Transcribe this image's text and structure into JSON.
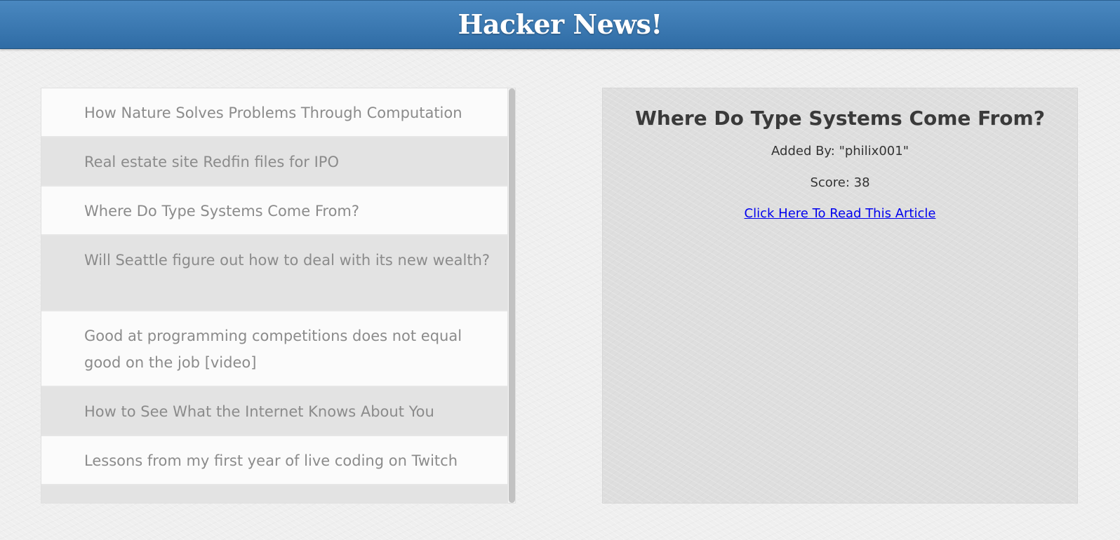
{
  "header": {
    "title": "Hacker News!",
    "background": "#3a78b2"
  },
  "stories": [
    {
      "title": "How Nature Solves Problems Through Computation"
    },
    {
      "title": "Real estate site Redfin files for IPO"
    },
    {
      "title": "Where Do Type Systems Come From?"
    },
    {
      "title": "Will Seattle figure out how to deal with its new wealth?"
    },
    {
      "title": "Good at programming competitions does not equal good on the job [video]"
    },
    {
      "title": "How to See What the Internet Knows About You"
    },
    {
      "title": "Lessons from my first year of live coding on Twitch"
    }
  ],
  "detail": {
    "title": "Where Do Type Systems Come From?",
    "author_text": "Added By: \"philix001\"",
    "score_text": "Score: 38",
    "link_text": "Click Here To Read This Article"
  },
  "colors": {
    "link": "#0000ee",
    "story_text": "#8b8b8b"
  }
}
